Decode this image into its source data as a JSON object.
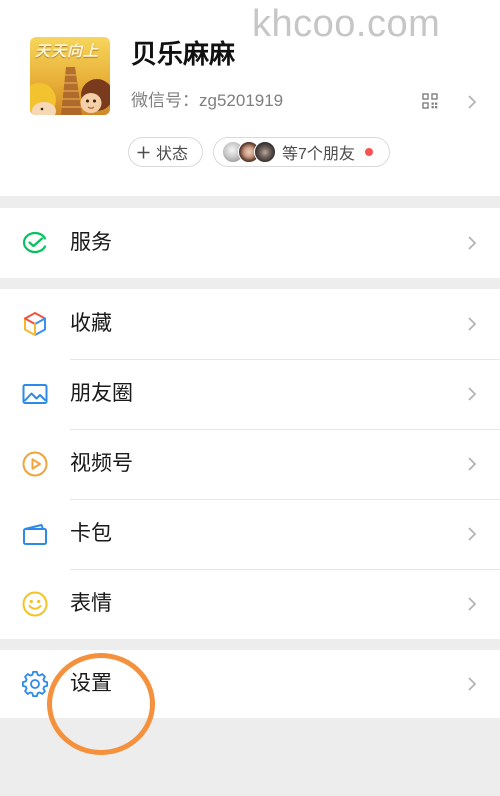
{
  "watermark": "khcoo.com",
  "profile": {
    "avatar": {
      "icon": "user-avatar",
      "text": "天天向上"
    },
    "name": "贝乐麻麻",
    "wechat_id": "微信号：zg5201919",
    "qr_code_icon": "qr-code-icon",
    "chevron_icon": "chevron-right-icon",
    "status_button": {
      "icon": "plus-icon",
      "label": "状态"
    },
    "friends_status": {
      "avatar_icons": [
        "friend-avatar-icon",
        "friend-avatar-icon",
        "friend-avatar-icon"
      ],
      "label": "等7个朋友",
      "unread_dot": true
    }
  },
  "menu": [
    {
      "items": [
        {
          "label": "服务",
          "icon": "wechat-pay-service-icon"
        }
      ]
    },
    {
      "items": [
        {
          "label": "收藏",
          "icon": "favorites-cube-icon"
        },
        {
          "label": "朋友圈",
          "icon": "moments-picture-icon"
        },
        {
          "label": "视频号",
          "icon": "channels-play-icon"
        },
        {
          "label": "卡包",
          "icon": "card-wallet-icon"
        },
        {
          "label": "表情",
          "icon": "sticker-smiley-icon"
        }
      ]
    },
    {
      "items": [
        {
          "label": "设置",
          "icon": "settings-gear-icon"
        }
      ]
    }
  ],
  "annotation": {
    "color": "#f5913d"
  },
  "colors": {
    "background": "#ededed",
    "card": "#ffffff",
    "text": "#191919",
    "secondary_text": "#7f7f7f",
    "chevron": "#b4b4b4",
    "divider": "#e7e7e7",
    "unread_dot": "#fa5151",
    "wechat_green": "#07c160",
    "icon_blue": "#2d8ae9"
  }
}
